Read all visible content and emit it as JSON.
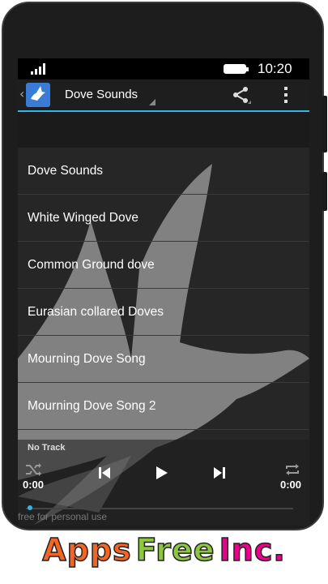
{
  "status_bar": {
    "time": "10:20",
    "signal_icon": "signal-icon",
    "battery_icon": "battery-icon"
  },
  "action_bar": {
    "title": "Dove Sounds",
    "share_icon": "share-icon",
    "overflow_icon": "overflow-menu-icon",
    "accent": "#33b5e5"
  },
  "list": {
    "items": [
      {
        "label": "Dove Sounds"
      },
      {
        "label": "White Winged Dove"
      },
      {
        "label": "Common Ground dove"
      },
      {
        "label": "Eurasian collared Doves"
      },
      {
        "label": "Mourning Dove Song"
      },
      {
        "label": "Mourning Dove Song 2"
      }
    ]
  },
  "player": {
    "track_label": "No Track",
    "time_elapsed": "0:00",
    "time_total": "0:00",
    "watermark": "free for personal use"
  },
  "brand": {
    "parts": [
      {
        "text": "Apps",
        "color": "#f26522"
      },
      {
        "text": "Free",
        "color": "#8dc63f"
      },
      {
        "text": "Inc.",
        "color": "#ec008c"
      }
    ]
  }
}
